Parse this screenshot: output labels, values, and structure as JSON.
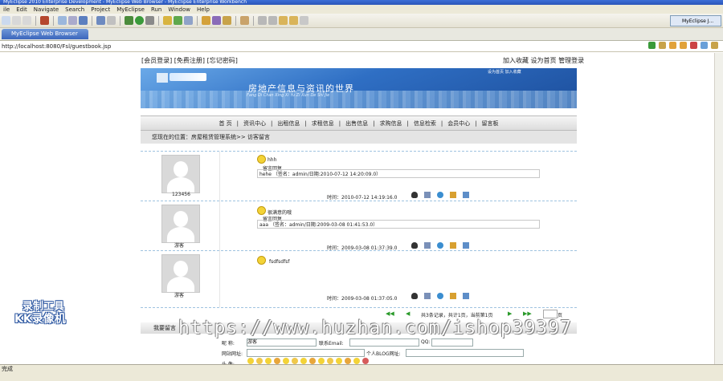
{
  "window": {
    "title": "MyEclipse 2010 Enterprise Development - MyEclipse Web Browser - MyEclipse Enterprise Workbench"
  },
  "menu": [
    "ile",
    "Edit",
    "Navigate",
    "Search",
    "Project",
    "MyEclipse",
    "Run",
    "Window",
    "Help"
  ],
  "perspective": "MyEclipse J...",
  "tab": {
    "label": "MyEclipse Web Browser"
  },
  "url": "http://localhost:8080/Fsl/guestbook.jsp",
  "page": {
    "toplinks": "[会员登录] [免费注册] [忘记密码]",
    "toplinks_right": "加入收藏 设为首页 管理登录",
    "banner_slogan": "房地产信息与资讯的世界",
    "banner_sub": "Fang Di Chan Xing Xi Yu Zi Xun De Shi Jie",
    "banner_links": "设为首页   加入收藏",
    "nav": [
      "首 页",
      "|",
      "资讯中心",
      "|",
      "出租信息",
      "|",
      "求租信息",
      "|",
      "出售信息",
      "|",
      "求购信息",
      "|",
      "信息检索",
      "|",
      "会员中心",
      "|",
      "留言板"
    ],
    "crumb": "您现在的位置：房屋租赁管理系统>> 访客留言",
    "messages": [
      {
        "user": "123456",
        "text": "hhh",
        "reply_label": "留言回复",
        "reply": "hehe （签名：admin/日期:2010-07-12 14:20:09.0）",
        "time": "时间：2010-07-12 14:19:16.0"
      },
      {
        "user": "游客",
        "text": "很满意的哦",
        "reply_label": "留言回复",
        "reply": "aaa （签名：admin/日期:2009-03-08 01:41:53.0）",
        "time": "时间：2009-03-08 01:37:39.0"
      },
      {
        "user": "游客",
        "text": "fsdfsdfsf",
        "reply_label": "",
        "reply": "",
        "time": "时间：2009-03-08 01:37:05.0"
      }
    ],
    "pager": "共3条记录，共计1页，当前第1页",
    "pager_go": "页",
    "form_title": "我要留言",
    "form": {
      "nick_label": "昵    称:",
      "nick_value": "游客",
      "email_label": "联系Email:",
      "qq_label": "QQ:",
      "site_label": "网站网址:",
      "blog_label": "个人BLOG网址:",
      "face_label": "头    像:"
    }
  },
  "watermark": "https://www.huzhan.com/ishop39397",
  "logo": {
    "line1": "录制工具",
    "line2": "KK录像机"
  },
  "status": "完成"
}
